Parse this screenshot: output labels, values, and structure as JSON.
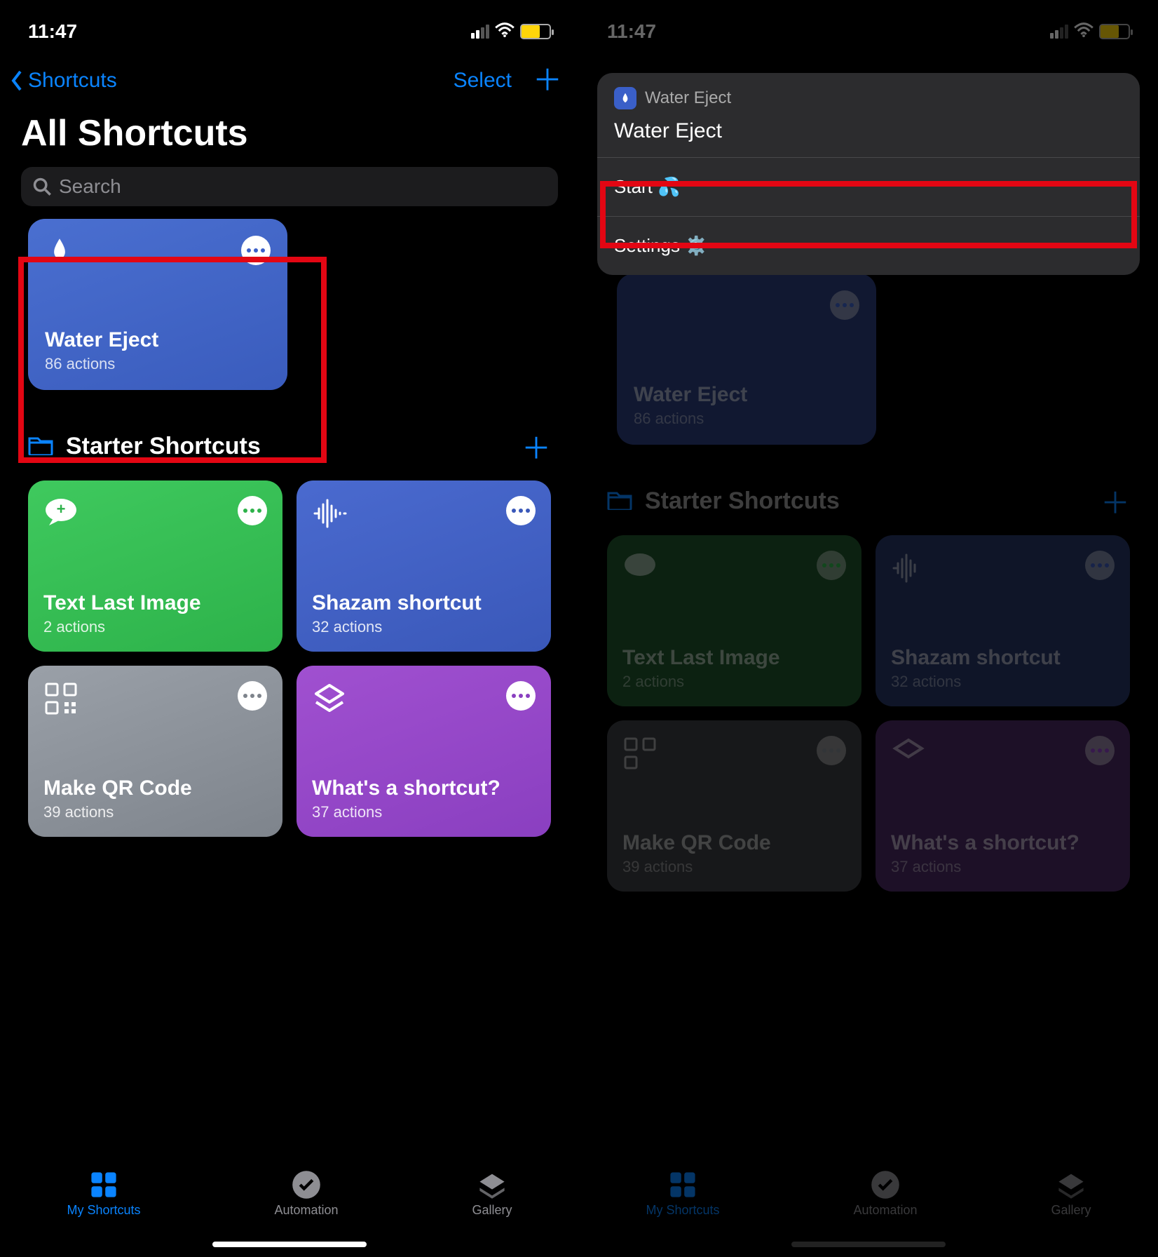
{
  "status": {
    "time": "11:47"
  },
  "nav": {
    "back": "Shortcuts",
    "select": "Select"
  },
  "title": "All Shortcuts",
  "search": {
    "placeholder": "Search"
  },
  "water_tile": {
    "label": "Water Eject",
    "sub": "86 actions"
  },
  "section": {
    "title": "Starter Shortcuts"
  },
  "tiles": [
    {
      "label": "Text Last Image",
      "sub": "2 actions"
    },
    {
      "label": "Shazam shortcut",
      "sub": "32 actions"
    },
    {
      "label": "Make QR Code",
      "sub": "39 actions"
    },
    {
      "label": "What's a shortcut?",
      "sub": "37 actions"
    }
  ],
  "tabs": {
    "my": "My Shortcuts",
    "auto": "Automation",
    "gallery": "Gallery"
  },
  "sheet": {
    "app": "Water Eject",
    "title": "Water Eject",
    "start": "Start 💦",
    "settings": "Settings ⚙️"
  }
}
